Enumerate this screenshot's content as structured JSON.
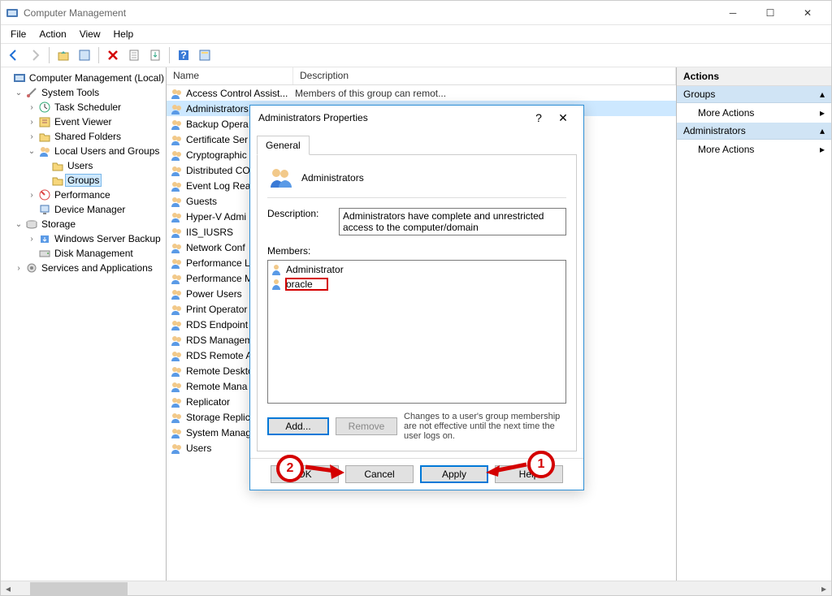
{
  "window": {
    "title": "Computer Management"
  },
  "menubar": [
    "File",
    "Action",
    "View",
    "Help"
  ],
  "tree": [
    {
      "label": "Computer Management (Local)",
      "indent": 0,
      "exp": "",
      "icon": "console"
    },
    {
      "label": "System Tools",
      "indent": 1,
      "exp": "v",
      "icon": "tools"
    },
    {
      "label": "Task Scheduler",
      "indent": 2,
      "exp": ">",
      "icon": "clock"
    },
    {
      "label": "Event Viewer",
      "indent": 2,
      "exp": ">",
      "icon": "event"
    },
    {
      "label": "Shared Folders",
      "indent": 2,
      "exp": ">",
      "icon": "folder"
    },
    {
      "label": "Local Users and Groups",
      "indent": 2,
      "exp": "v",
      "icon": "users"
    },
    {
      "label": "Users",
      "indent": 3,
      "exp": "",
      "icon": "yfolder"
    },
    {
      "label": "Groups",
      "indent": 3,
      "exp": "",
      "icon": "yfolder",
      "selected": true
    },
    {
      "label": "Performance",
      "indent": 2,
      "exp": ">",
      "icon": "perf"
    },
    {
      "label": "Device Manager",
      "indent": 2,
      "exp": "",
      "icon": "device"
    },
    {
      "label": "Storage",
      "indent": 1,
      "exp": "v",
      "icon": "storage"
    },
    {
      "label": "Windows Server Backup",
      "indent": 2,
      "exp": ">",
      "icon": "backup"
    },
    {
      "label": "Disk Management",
      "indent": 2,
      "exp": "",
      "icon": "disk"
    },
    {
      "label": "Services and Applications",
      "indent": 1,
      "exp": ">",
      "icon": "services"
    }
  ],
  "list": {
    "columns": {
      "name": "Name",
      "desc": "Description"
    },
    "rows": [
      {
        "name": "Access Control Assist...",
        "desc": "Members of this group can remot..."
      },
      {
        "name": "Administrators",
        "desc": "",
        "selected": true
      },
      {
        "name": "Backup Opera",
        "desc": ""
      },
      {
        "name": "Certificate Ser",
        "desc": ""
      },
      {
        "name": "Cryptographic",
        "desc": ""
      },
      {
        "name": "Distributed CO",
        "desc": ""
      },
      {
        "name": "Event Log Rea",
        "desc": ""
      },
      {
        "name": "Guests",
        "desc": ""
      },
      {
        "name": "Hyper-V Admi",
        "desc": ""
      },
      {
        "name": "IIS_IUSRS",
        "desc": ""
      },
      {
        "name": "Network Conf",
        "desc": ""
      },
      {
        "name": "Performance L",
        "desc": ""
      },
      {
        "name": "Performance M",
        "desc": ""
      },
      {
        "name": "Power Users",
        "desc": ""
      },
      {
        "name": "Print Operator",
        "desc": ""
      },
      {
        "name": "RDS Endpoint",
        "desc": ""
      },
      {
        "name": "RDS Managem",
        "desc": ""
      },
      {
        "name": "RDS Remote A",
        "desc": ""
      },
      {
        "name": "Remote Deskto",
        "desc": ""
      },
      {
        "name": "Remote Mana",
        "desc": ""
      },
      {
        "name": "Replicator",
        "desc": ""
      },
      {
        "name": "Storage Replic",
        "desc": ""
      },
      {
        "name": "System Manag",
        "desc": ""
      },
      {
        "name": "Users",
        "desc": ""
      }
    ]
  },
  "actions": {
    "header": "Actions",
    "section1": "Groups",
    "item1": "More Actions",
    "section2": "Administrators",
    "item2": "More Actions"
  },
  "dialog": {
    "title": "Administrators Properties",
    "tab": "General",
    "heading": "Administrators",
    "descLabel": "Description:",
    "descValue": "Administrators have complete and unrestricted access to the computer/domain",
    "membersLabel": "Members:",
    "members": [
      {
        "name": "Administrator"
      },
      {
        "name": "oracle",
        "highlight": true
      }
    ],
    "addLabel": "Add...",
    "removeLabel": "Remove",
    "note": "Changes to a user's group membership are not effective until the next time the user logs on.",
    "ok": "OK",
    "cancel": "Cancel",
    "apply": "Apply",
    "help": "Help"
  },
  "annotations": {
    "step1": "1",
    "step2": "2"
  }
}
